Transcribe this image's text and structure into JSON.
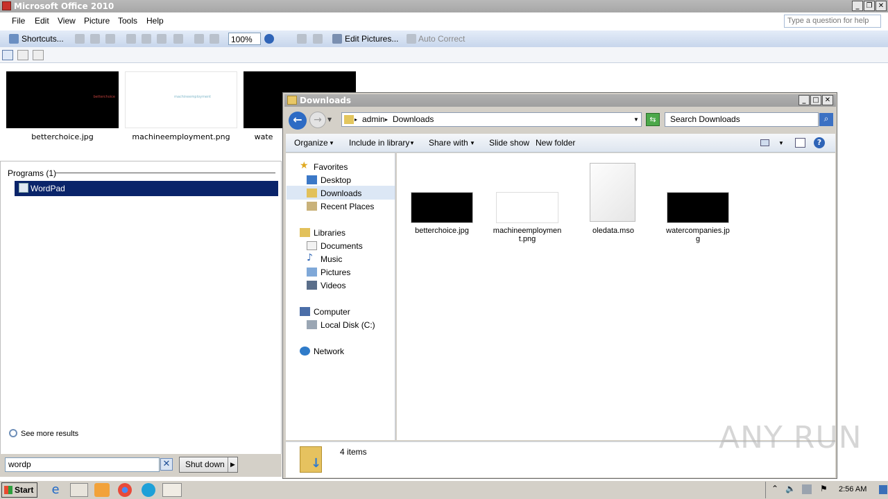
{
  "office": {
    "title": "Microsoft Office 2010",
    "menu": [
      "File",
      "Edit",
      "View",
      "Picture",
      "Tools",
      "Help"
    ],
    "help_placeholder": "Type a question for help",
    "toolbar": {
      "shortcuts": "Shortcuts...",
      "zoom": "100%",
      "edit_pictures": "Edit Pictures...",
      "auto_correct": "Auto Correct"
    },
    "thumbnails": [
      {
        "label": "betterchoice.jpg",
        "caption": "betterchoice"
      },
      {
        "label": "machineemployment.png",
        "caption": "machineemployment"
      },
      {
        "label": "wate"
      }
    ]
  },
  "start_menu": {
    "programs_header": "Programs (1)",
    "result": "WordPad",
    "see_more": "See more results",
    "search_value": "wordp",
    "shutdown": "Shut down"
  },
  "explorer": {
    "title": "Downloads",
    "breadcrumb": [
      "admin",
      "Downloads"
    ],
    "search_placeholder": "Search Downloads",
    "commands": [
      "Organize",
      "Include in library",
      "Share with",
      "Slide show",
      "New folder"
    ],
    "nav": {
      "favorites": "Favorites",
      "desktop": "Desktop",
      "downloads": "Downloads",
      "recent": "Recent Places",
      "libraries": "Libraries",
      "documents": "Documents",
      "music": "Music",
      "pictures": "Pictures",
      "videos": "Videos",
      "computer": "Computer",
      "local_disk": "Local Disk (C:)",
      "network": "Network"
    },
    "files": [
      {
        "line1": "betterchoice.jpg",
        "line2": ""
      },
      {
        "line1": "machineemploymen",
        "line2": "t.png"
      },
      {
        "line1": "oledata.mso",
        "line2": ""
      },
      {
        "line1": "watercompanies.jp",
        "line2": "g"
      }
    ],
    "item_count": "4 items"
  },
  "taskbar": {
    "start": "Start",
    "clock": "2:56 AM"
  },
  "watermark": "ANY RUN"
}
